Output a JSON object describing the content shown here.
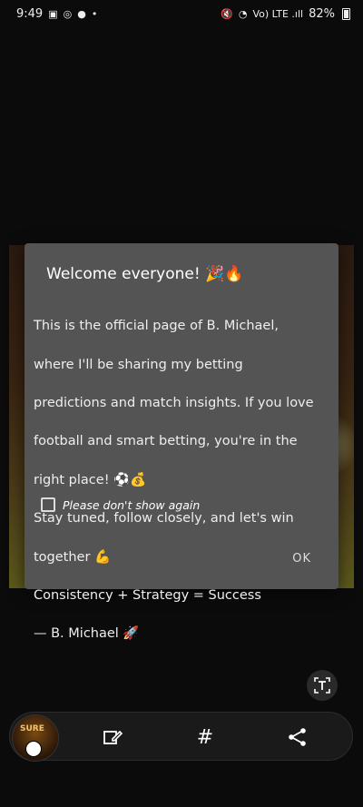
{
  "status_bar": {
    "time": "9:49",
    "battery": "82%",
    "network": "Vo) LTE .ıll"
  },
  "dialog": {
    "title": "Welcome everyone! 🎉🔥",
    "body_lines": [
      "This is the official page of B. Michael,",
      "where I'll be sharing my betting",
      "predictions and match insights. If you love",
      "football and smart betting, you're in the",
      "right place! ⚽💰",
      "Stay tuned, follow closely, and let's win",
      "together 💪",
      "Consistency + Strategy = Success",
      "— B. Michael 🚀"
    ],
    "checkbox_label": "Please don't show again",
    "ok_label": "OK"
  },
  "thumbnail": {
    "label": "SURE"
  },
  "toolbar": {
    "hashtag_symbol": "#"
  }
}
